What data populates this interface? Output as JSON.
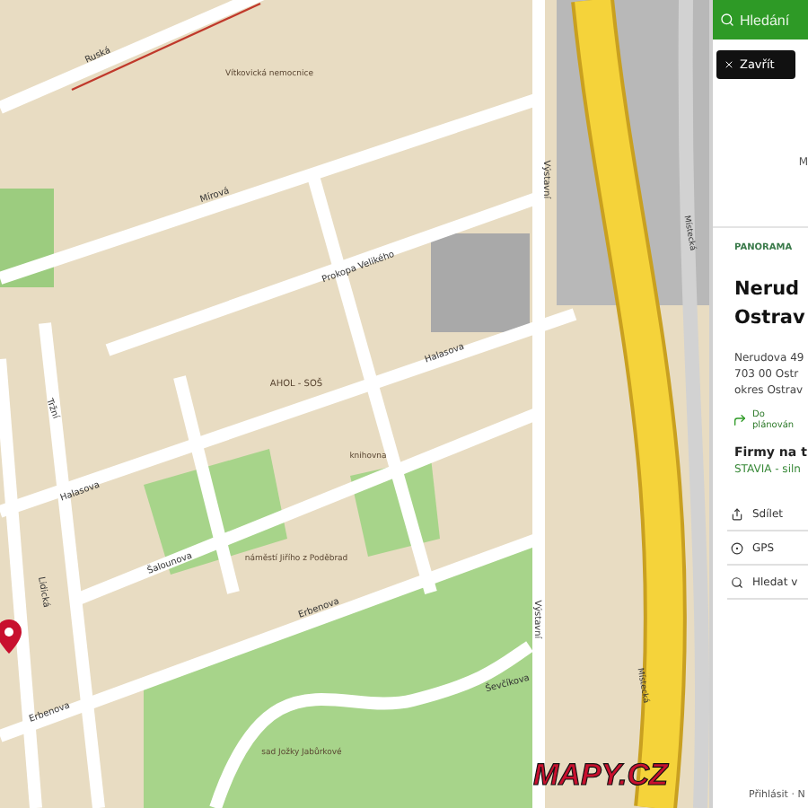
{
  "map": {
    "labels": [
      {
        "kind": "street",
        "text": "Ruská"
      },
      {
        "kind": "street",
        "text": "Mírová"
      },
      {
        "kind": "place",
        "text": "Vítkovická nemocnice"
      },
      {
        "kind": "street",
        "text": "Prokopa Velikého"
      },
      {
        "kind": "street",
        "text": "Halasova"
      },
      {
        "kind": "street",
        "text": "Halasova"
      },
      {
        "kind": "place",
        "text": "AHOL - SOŠ"
      },
      {
        "kind": "place",
        "text": "knihovna"
      },
      {
        "kind": "street",
        "text": "Šalounova"
      },
      {
        "kind": "place",
        "text": "náměstí Jiřího z Poděbrad"
      },
      {
        "kind": "street",
        "text": "Erbenova"
      },
      {
        "kind": "street",
        "text": "Erbenova"
      },
      {
        "kind": "street",
        "text": "Výstavní"
      },
      {
        "kind": "street",
        "text": "Výstavní"
      },
      {
        "kind": "street",
        "text": "Místecká"
      },
      {
        "kind": "street",
        "text": "Místecká"
      },
      {
        "kind": "street",
        "text": "Lidická"
      },
      {
        "kind": "street",
        "text": "Tržní"
      },
      {
        "kind": "street",
        "text": "Ševčíkova"
      },
      {
        "kind": "place",
        "text": "sad Jožky Jabůrkové"
      }
    ],
    "logo": "MAPY.CZ"
  },
  "panel": {
    "search": {
      "placeholder": "Hledání"
    },
    "close": "Zavřít",
    "photo_caption": "M",
    "category": "PANORAMA",
    "title_lines": [
      "Nerud",
      "Ostrav"
    ],
    "address_lines": [
      "Nerudova 49",
      "703 00  Ostr",
      "okres Ostrav"
    ],
    "route_lines": [
      "Do",
      "plánován"
    ],
    "firms_heading": "Firmy na t",
    "firm": "STAVIA - siln",
    "actions": [
      {
        "kind": "share",
        "label": "Sdílet"
      },
      {
        "kind": "gps",
        "label": "GPS"
      },
      {
        "kind": "search",
        "label": "Hledat v"
      }
    ],
    "footer": "Přihlásit · N"
  }
}
